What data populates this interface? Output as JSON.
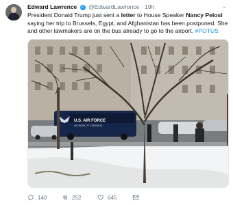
{
  "tweet": {
    "author_name": "Edward Lawrence",
    "verified_icon": "verified-badge-icon",
    "handle": "@EdwardLawrence",
    "separator": "·",
    "time": "19h",
    "text": {
      "p1": "President Donald Trump just sent a ",
      "b1": "letter",
      "p2": " to House Speaker ",
      "b2": "Nancy Pelosi",
      "p3": " saying her trip to Brussels, Egypt, and Afghanistan has been postponed. She and other lawmakers are on the bus already to go to the airport. ",
      "hashtag": "#POTUS"
    },
    "photo": {
      "bus_sign_line1": "U.S. AIR FORCE",
      "bus_sign_line2": "AIR MOBILITY COMMAND"
    },
    "actions": {
      "replies": "140",
      "retweets": "252",
      "likes": "645"
    }
  }
}
